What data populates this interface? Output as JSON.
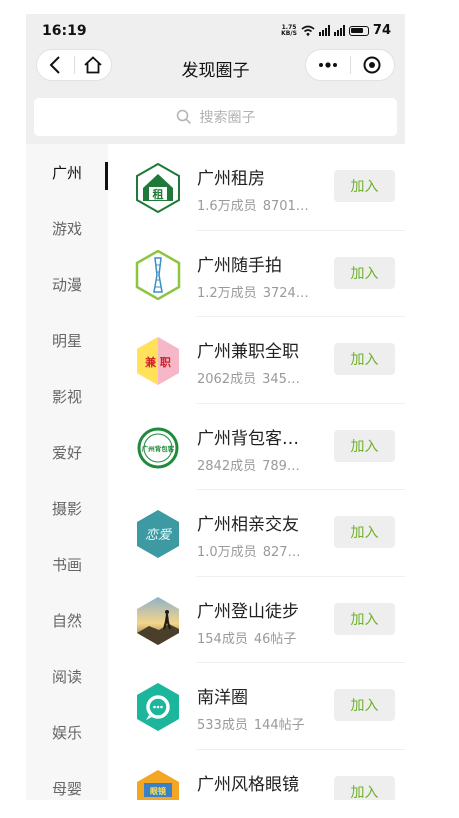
{
  "status_bar": {
    "time": "16:19",
    "net_speed_value": "1.75",
    "net_speed_unit": "KB/S",
    "battery": "74"
  },
  "nav": {
    "title": "发现圈子"
  },
  "search": {
    "placeholder": "搜索圈子"
  },
  "categories": [
    "广州",
    "游戏",
    "动漫",
    "明星",
    "影视",
    "爱好",
    "摄影",
    "书画",
    "自然",
    "阅读",
    "娱乐",
    "母婴"
  ],
  "active_category": "广州",
  "circles": [
    {
      "name": "广州租房",
      "members": "1.6万成员",
      "posts": "8701…",
      "join": "加入",
      "avatar_text": "租",
      "icon": "house-logo"
    },
    {
      "name": "广州随手拍",
      "members": "1.2万成员",
      "posts": "3724…",
      "join": "加入",
      "avatar_text": "",
      "icon": "canton-tower-logo"
    },
    {
      "name": "广州兼职全职",
      "members": "2062成员",
      "posts": "345…",
      "join": "加入",
      "avatar_text": "兼 职",
      "icon": "part-time-logo"
    },
    {
      "name": "广州背包客…",
      "members": "2842成员",
      "posts": "789…",
      "join": "加入",
      "avatar_text": "广州背包客",
      "icon": "backpacker-logo"
    },
    {
      "name": "广州相亲交友",
      "members": "1.0万成员",
      "posts": "827…",
      "join": "加入",
      "avatar_text": "恋爱",
      "icon": "dating-logo"
    },
    {
      "name": "广州登山徒步",
      "members": "154成员",
      "posts": "46帖子",
      "join": "加入",
      "avatar_text": "",
      "icon": "hiker-photo"
    },
    {
      "name": "南洋圈",
      "members": "533成员",
      "posts": "144帖子",
      "join": "加入",
      "avatar_text": "",
      "icon": "chat-ring-logo"
    },
    {
      "name": "广州风格眼镜",
      "members": "",
      "posts": "",
      "join": "加入",
      "avatar_text": "眼镜",
      "icon": "glasses-logo"
    }
  ],
  "colors": {
    "accent_green": "#6fb12a",
    "join_bg": "#eeeeee",
    "page_bg": "#efefef"
  }
}
